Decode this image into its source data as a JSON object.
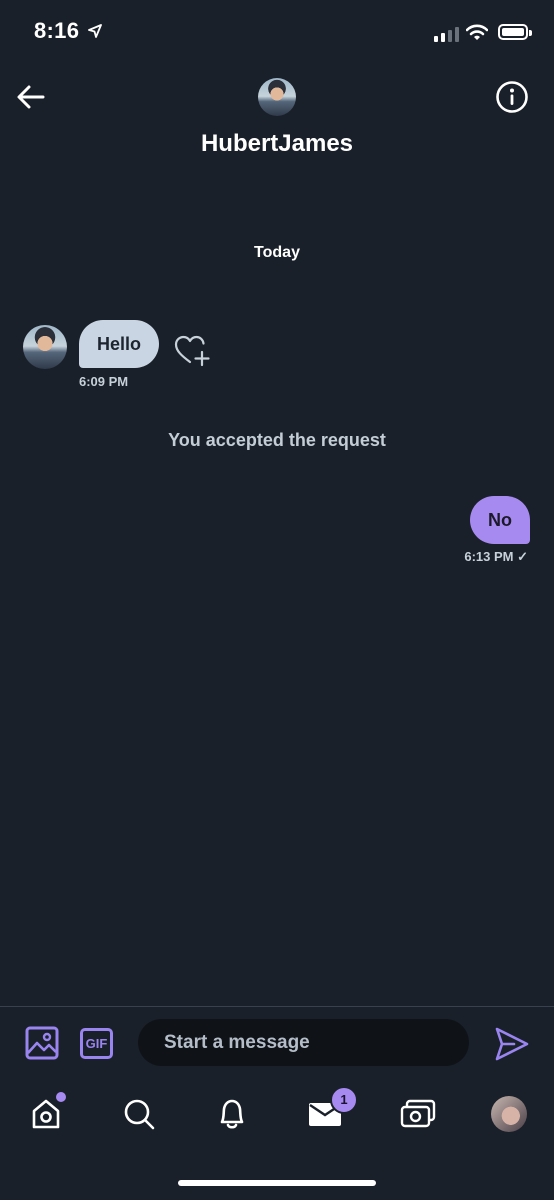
{
  "status_bar": {
    "time": "8:16",
    "icons": [
      "location-arrow-icon",
      "cellular-signal-icon",
      "wifi-icon",
      "battery-icon"
    ]
  },
  "header": {
    "name": "HubertJames",
    "icons": [
      "back-arrow-icon",
      "info-icon"
    ]
  },
  "conversation": {
    "date_separator": "Today",
    "messages": [
      {
        "direction": "incoming",
        "text": "Hello",
        "time": "6:09 PM"
      },
      {
        "direction": "outgoing",
        "text": "No",
        "time": "6:13 PM ✓"
      }
    ],
    "system_message": "You accepted the request"
  },
  "composer": {
    "gif_label": "GIF",
    "placeholder": "Start a message",
    "value": ""
  },
  "nav": {
    "items": [
      {
        "name": "home",
        "icon": "home-icon",
        "has_dot": true
      },
      {
        "name": "search",
        "icon": "search-icon"
      },
      {
        "name": "notifications",
        "icon": "bell-icon"
      },
      {
        "name": "messages",
        "icon": "mail-icon",
        "badge": "1"
      },
      {
        "name": "money",
        "icon": "money-icon"
      },
      {
        "name": "profile",
        "icon": "avatar"
      }
    ]
  },
  "colors": {
    "background": "#192029",
    "accent": "#a68af0",
    "incoming_bubble": "#c9d5e3"
  }
}
